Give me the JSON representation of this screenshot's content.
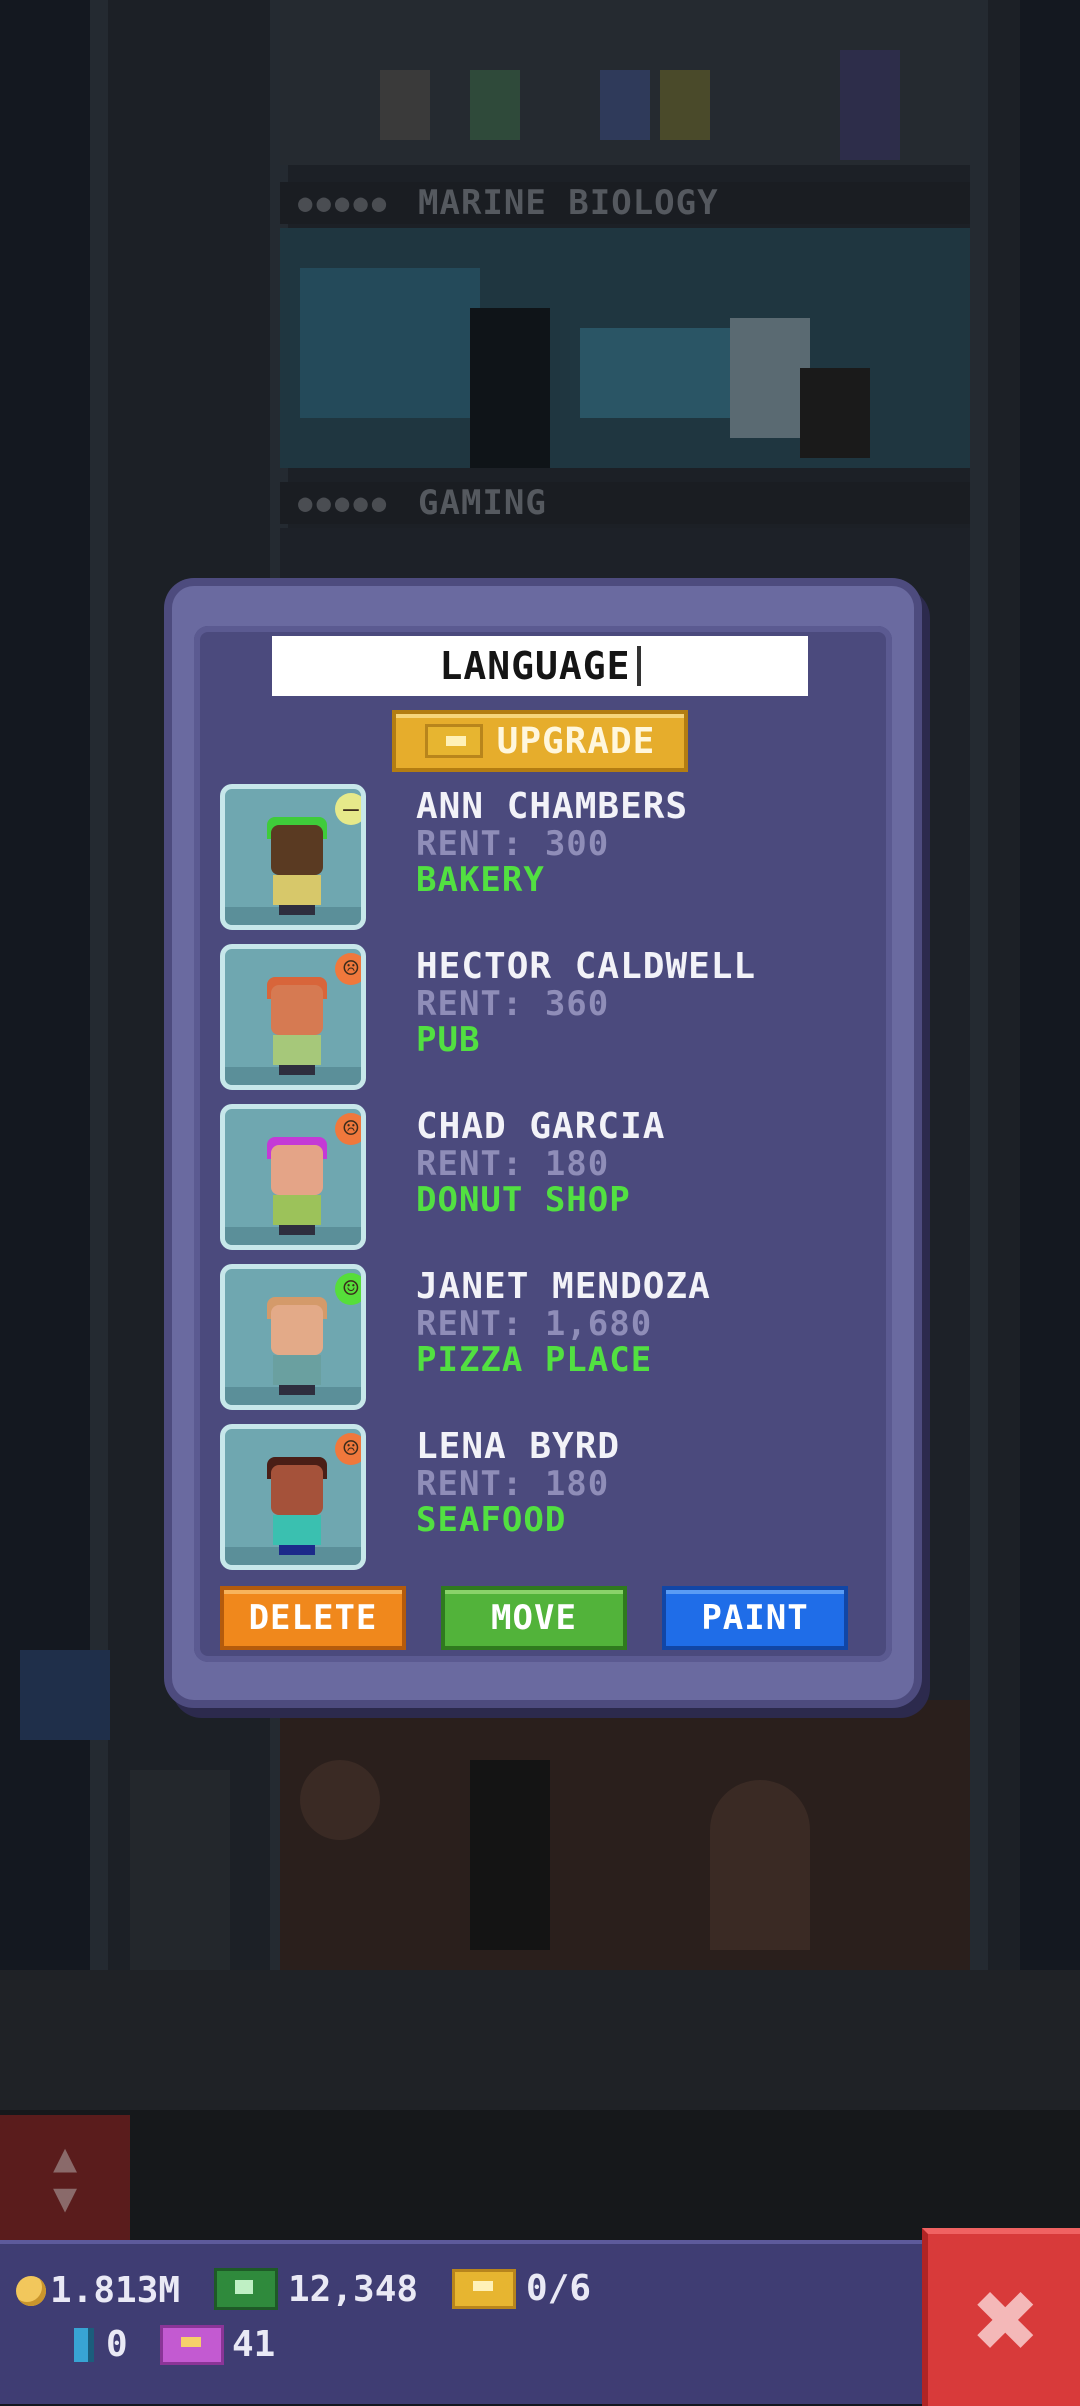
{
  "background": {
    "floors": [
      {
        "name": "MARINE BIOLOGY"
      },
      {
        "name": "GAMING"
      }
    ]
  },
  "dialog": {
    "floor_name_value": "LANGUAGE",
    "upgrade_label": "UPGRADE",
    "tenants": [
      {
        "name": "ANN CHAMBERS",
        "rent": "RENT: 300",
        "business": "BAKERY",
        "mood": "neutral",
        "mood_color": "#e6e98a",
        "hair_color": "#3fcc3a",
        "skin_color": "#5a3a22",
        "shirt_color": "#d7c86a"
      },
      {
        "name": "HECTOR CALDWELL",
        "rent": "RENT: 360",
        "business": "PUB",
        "mood": "sad",
        "mood_color": "#f0783c",
        "hair_color": "#d8653a",
        "skin_color": "#d67a52",
        "shirt_color": "#a6c87a"
      },
      {
        "name": "CHAD GARCIA",
        "rent": "RENT: 180",
        "business": "DONUT SHOP",
        "mood": "sad",
        "mood_color": "#f0783c",
        "hair_color": "#c43ad6",
        "skin_color": "#e4a487",
        "shirt_color": "#9cc25a"
      },
      {
        "name": "JANET MENDOZA",
        "rent": "RENT: 1,680",
        "business": "PIZZA PLACE",
        "mood": "happy",
        "mood_color": "#56de3a",
        "hair_color": "#d49a6a",
        "skin_color": "#e3aa88",
        "shirt_color": "#6aa0a0"
      },
      {
        "name": "LENA BYRD",
        "rent": "RENT: 180",
        "business": "SEAFOOD",
        "mood": "sad",
        "mood_color": "#f0783c",
        "hair_color": "#4a1e16",
        "skin_color": "#a5523a",
        "shirt_color": "#3ac0b0"
      }
    ],
    "buttons": {
      "delete": "DELETE",
      "move": "MOVE",
      "paint": "PAINT"
    }
  },
  "status": {
    "coins": "1.813M",
    "cash": "12,348",
    "tickets": "0/6",
    "bux": "0",
    "vip": "41"
  },
  "colors": {
    "upgrade": "#e6ad2c",
    "delete": "#f0881c",
    "move": "#52b33a",
    "paint": "#1f6de8",
    "close": "#d83a3a",
    "business_text": "#52e041"
  }
}
